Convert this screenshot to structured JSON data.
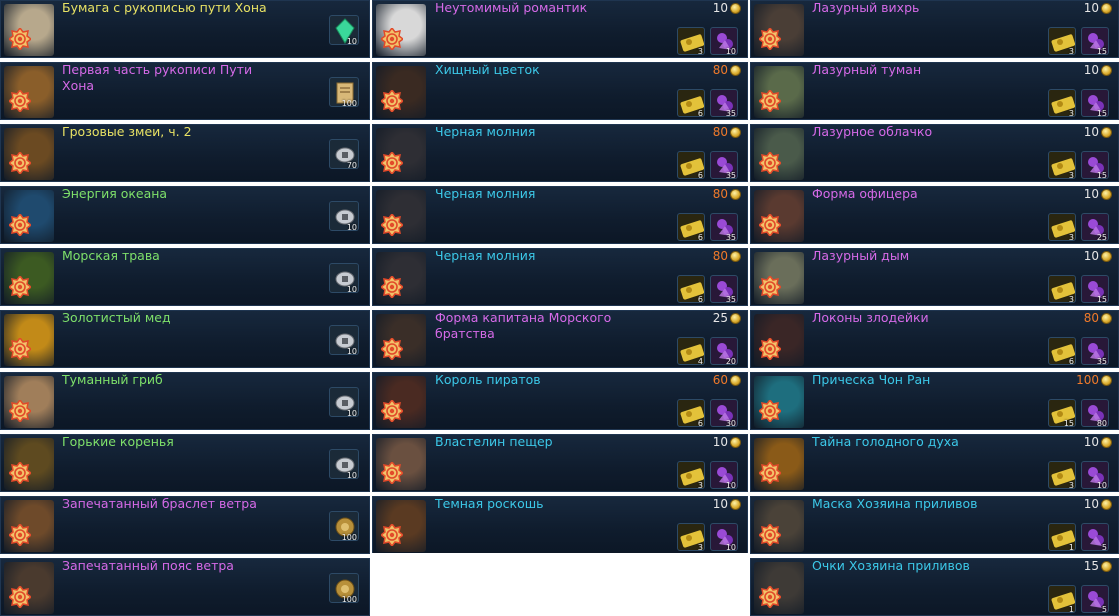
{
  "colors": {
    "name_yellow": "#e8e264",
    "name_purple": "#d66ae8",
    "name_cyan": "#3cc8e8",
    "name_green": "#7ee06a",
    "price_orange": "#f07a2a",
    "price_white": "#e6e6e6"
  },
  "column1": [
    {
      "name": "Бумага с рукописью пути Хона",
      "color": "yellow",
      "count": "10",
      "icon": "emerald-icon",
      "thumb": "#b7a88c"
    },
    {
      "name": "Первая часть рукописи Пути Хона",
      "color": "purple",
      "count": "100",
      "icon": "scroll-icon",
      "thumb": "#8a5e2a"
    },
    {
      "name": "Грозовые змеи, ч. 2",
      "color": "yellow",
      "count": "70",
      "icon": "silver-ingot-icon",
      "thumb": "#6b4a22"
    },
    {
      "name": "Энергия океана",
      "color": "green",
      "count": "10",
      "icon": "silver-ingot-icon",
      "thumb": "#1f4a6e"
    },
    {
      "name": "Морская трава",
      "color": "green",
      "count": "10",
      "icon": "silver-ingot-icon",
      "thumb": "#3c5a22"
    },
    {
      "name": "Золотистый мед",
      "color": "green",
      "count": "10",
      "icon": "silver-ingot-icon",
      "thumb": "#c28a18"
    },
    {
      "name": "Туманный гриб",
      "color": "green",
      "count": "10",
      "icon": "silver-ingot-icon",
      "thumb": "#a07e5a"
    },
    {
      "name": "Горькие коренья",
      "color": "green",
      "count": "10",
      "icon": "silver-ingot-icon",
      "thumb": "#5e4a20"
    },
    {
      "name": "Запечатанный браслет ветра",
      "color": "purple",
      "count": "100",
      "icon": "gold-pouch-icon",
      "thumb": "#6e4a2a"
    },
    {
      "name": "Запечатанный пояс ветра",
      "color": "purple",
      "count": "100",
      "icon": "gold-pouch-icon",
      "thumb": "#4a3a2e"
    }
  ],
  "column2": [
    {
      "name": "Неутомимый романтик",
      "color": "purple",
      "price": "10",
      "orange": false,
      "tickets": "3",
      "essence": "10",
      "thumb": "#d8d8d8"
    },
    {
      "name": "Хищный цветок",
      "color": "cyan",
      "price": "80",
      "orange": true,
      "tickets": "6",
      "essence": "35",
      "thumb": "#3a2a22"
    },
    {
      "name": "Черная молния",
      "color": "cyan",
      "price": "80",
      "orange": true,
      "tickets": "6",
      "essence": "35",
      "thumb": "#2e2e34"
    },
    {
      "name": "Черная молния",
      "color": "cyan",
      "price": "80",
      "orange": true,
      "tickets": "6",
      "essence": "35",
      "thumb": "#2e2e34"
    },
    {
      "name": "Черная молния",
      "color": "cyan",
      "price": "80",
      "orange": true,
      "tickets": "6",
      "essence": "35",
      "thumb": "#2e2e34"
    },
    {
      "name": "Форма капитана Морского братства",
      "color": "purple",
      "price": "25",
      "orange": false,
      "tickets": "4",
      "essence": "20",
      "thumb": "#3a2e28"
    },
    {
      "name": "Король пиратов",
      "color": "cyan",
      "price": "60",
      "orange": true,
      "tickets": "6",
      "essence": "30",
      "thumb": "#4a2a22"
    },
    {
      "name": "Властелин пещер",
      "color": "cyan",
      "price": "10",
      "orange": false,
      "tickets": "3",
      "essence": "10",
      "thumb": "#6a5040"
    },
    {
      "name": "Темная роскошь",
      "color": "cyan",
      "price": "10",
      "orange": false,
      "tickets": "3",
      "essence": "10",
      "thumb": "#5a3a22"
    }
  ],
  "column3": [
    {
      "name": "Лазурный вихрь",
      "color": "purple",
      "price": "10",
      "orange": false,
      "tickets": "3",
      "essence": "15",
      "thumb": "#4a3e36"
    },
    {
      "name": "Лазурный туман",
      "color": "purple",
      "price": "10",
      "orange": false,
      "tickets": "3",
      "essence": "15",
      "thumb": "#5a6a4a"
    },
    {
      "name": "Лазурное облачко",
      "color": "purple",
      "price": "10",
      "orange": false,
      "tickets": "3",
      "essence": "15",
      "thumb": "#4a5a4a"
    },
    {
      "name": "Форма офицера",
      "color": "purple",
      "price": "10",
      "orange": false,
      "tickets": "3",
      "essence": "25",
      "thumb": "#5a3a30"
    },
    {
      "name": "Лазурный дым",
      "color": "purple",
      "price": "10",
      "orange": false,
      "tickets": "3",
      "essence": "15",
      "thumb": "#6a6e5a"
    },
    {
      "name": "Локоны злодейки",
      "color": "purple",
      "price": "80",
      "orange": true,
      "tickets": "6",
      "essence": "35",
      "thumb": "#3a2626"
    },
    {
      "name": "Прическа Чон Ран",
      "color": "cyan",
      "price": "100",
      "orange": true,
      "tickets": "15",
      "essence": "80",
      "thumb": "#1e6e7e"
    },
    {
      "name": "Тайна голодного духа",
      "color": "cyan",
      "price": "10",
      "orange": false,
      "tickets": "3",
      "essence": "10",
      "thumb": "#8a5a18"
    },
    {
      "name": "Маска Хозяина приливов",
      "color": "cyan",
      "price": "10",
      "orange": false,
      "tickets": "1",
      "essence": "5",
      "thumb": "#4a4238"
    },
    {
      "name": "Очки Хозяина приливов",
      "color": "cyan",
      "price": "15",
      "orange": false,
      "tickets": "1",
      "essence": "5",
      "thumb": "#3e3a36"
    }
  ]
}
